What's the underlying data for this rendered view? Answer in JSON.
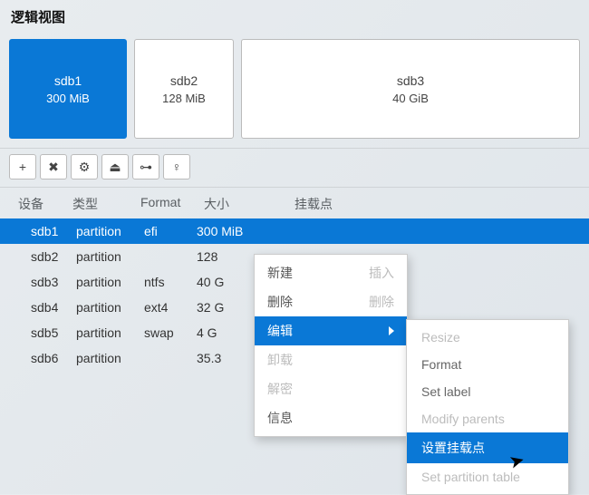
{
  "header": {
    "title": "逻辑视图"
  },
  "partition_blocks": [
    {
      "name": "sdb1",
      "size": "300 MiB",
      "selected": true
    },
    {
      "name": "sdb2",
      "size": "128 MiB",
      "selected": false
    },
    {
      "name": "sdb3",
      "size": "40 GiB",
      "selected": false
    }
  ],
  "toolbar_icons": {
    "add": "+",
    "remove": "✖",
    "settings": "⚙",
    "eject": "⏏",
    "lock": "⊶",
    "hint": "♀"
  },
  "columns": {
    "device": "设备",
    "type": "类型",
    "format": "Format",
    "size": "大小",
    "mount": "挂载点"
  },
  "rows": [
    {
      "device": "sdb1",
      "type": "partition",
      "format": "efi",
      "size": "300 MiB",
      "selected": true
    },
    {
      "device": "sdb2",
      "type": "partition",
      "format": "",
      "size": "128",
      "selected": false
    },
    {
      "device": "sdb3",
      "type": "partition",
      "format": "ntfs",
      "size": "40 G",
      "selected": false
    },
    {
      "device": "sdb4",
      "type": "partition",
      "format": "ext4",
      "size": "32 G",
      "selected": false
    },
    {
      "device": "sdb5",
      "type": "partition",
      "format": "swap",
      "size": "4 G",
      "selected": false
    },
    {
      "device": "sdb6",
      "type": "partition",
      "format": "",
      "size": "35.3",
      "selected": false
    }
  ],
  "context_menu": {
    "new": "新建",
    "insert": "插入",
    "delete": "删除",
    "delete_right": "删除",
    "edit": "编辑",
    "unmount": "卸载",
    "decrypt": "解密",
    "info": "信息"
  },
  "edit_submenu": {
    "resize": "Resize",
    "format": "Format",
    "set_label": "Set label",
    "modify_parents": "Modify parents",
    "set_mount": "设置挂载点",
    "set_partition_table": "Set partition table"
  }
}
